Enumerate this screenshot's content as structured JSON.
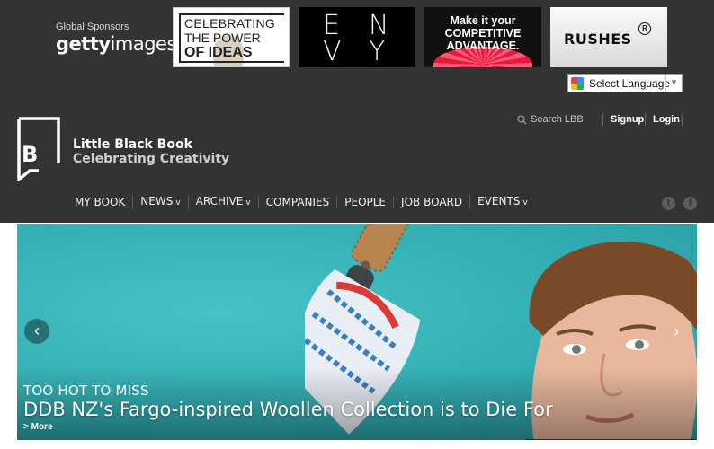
{
  "sponsors": {
    "label": "Global Sponsors",
    "getty_bold": "getty",
    "getty_light": "images",
    "ads": [
      {
        "name": "celebrating-ideas-ad",
        "lines": [
          "CELEBRATING",
          "THE POWER",
          "OF IDEAS"
        ]
      },
      {
        "name": "envy-ad",
        "letters": [
          "E",
          "N",
          "V",
          "Y"
        ]
      },
      {
        "name": "competitive-advantage-ad",
        "lines": [
          "Make it your",
          "COMPETITIVE",
          "ADVANTAGE."
        ]
      },
      {
        "name": "rushes-ad",
        "text": "RUSHES",
        "mark": "R"
      }
    ]
  },
  "language": {
    "label": "Select Language",
    "caret": "▼"
  },
  "utility": {
    "search_placeholder": "Search LBB",
    "signup": "Signup",
    "login": "Login"
  },
  "brand": {
    "logo_letter": "B",
    "name": "Little Black Book",
    "tagline": "Celebrating Creativity"
  },
  "nav": {
    "items": [
      {
        "label": "MY BOOK",
        "dropdown": false
      },
      {
        "label": "NEWS",
        "dropdown": true
      },
      {
        "label": "ARCHIVE",
        "dropdown": true
      },
      {
        "label": "COMPANIES",
        "dropdown": false
      },
      {
        "label": "PEOPLE",
        "dropdown": false
      },
      {
        "label": "JOB BOARD",
        "dropdown": false
      },
      {
        "label": "EVENTS",
        "dropdown": true
      }
    ],
    "chevron": "v"
  },
  "social": {
    "twitter": "t",
    "facebook": "f"
  },
  "hero": {
    "kicker": "TOO HOT TO MISS",
    "title": "DDB NZ's Fargo-inspired Woollen Collection is to Die For",
    "more": "> More",
    "prev": "‹",
    "next": "›"
  },
  "colors": {
    "header_bg": "#333333",
    "hero_teal": "#37b3b8",
    "ad_red": "#e8193c"
  }
}
